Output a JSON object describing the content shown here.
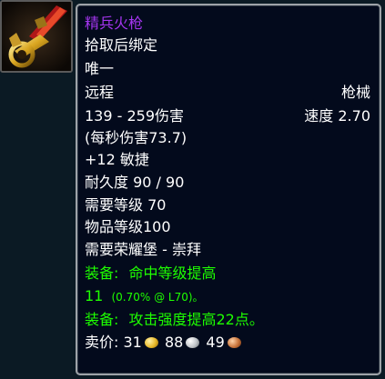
{
  "item": {
    "icon": "rifle-icon",
    "name": "精兵火枪",
    "bind": "拾取后绑定",
    "unique": "唯一",
    "slot": "远程",
    "weapon_type": "枪械",
    "damage": "139 - 259伤害",
    "speed": "速度 2.70",
    "dps": "(每秒伤害73.7)",
    "stat": "+12 敏捷",
    "durability": "耐久度 90 / 90",
    "required_level": "需要等级 70",
    "item_level": "物品等级100",
    "reputation": "需要荣耀堡 - 崇拜",
    "equip1_label": "装备:",
    "equip1_text": "命中等级提高",
    "equip1_value": "11",
    "equip1_detail": "(0.70% @ L70)。",
    "equip2_label": "装备:",
    "equip2_text": "攻击强度提高22点。",
    "sell_label": "卖价:",
    "sell_gold": "31",
    "sell_silver": "88",
    "sell_copper": "49"
  },
  "colors": {
    "epic": "#a335ee",
    "equip": "#1eff00",
    "text": "#ffffff",
    "background": "#030a1c",
    "border": "#9ea3a8"
  }
}
